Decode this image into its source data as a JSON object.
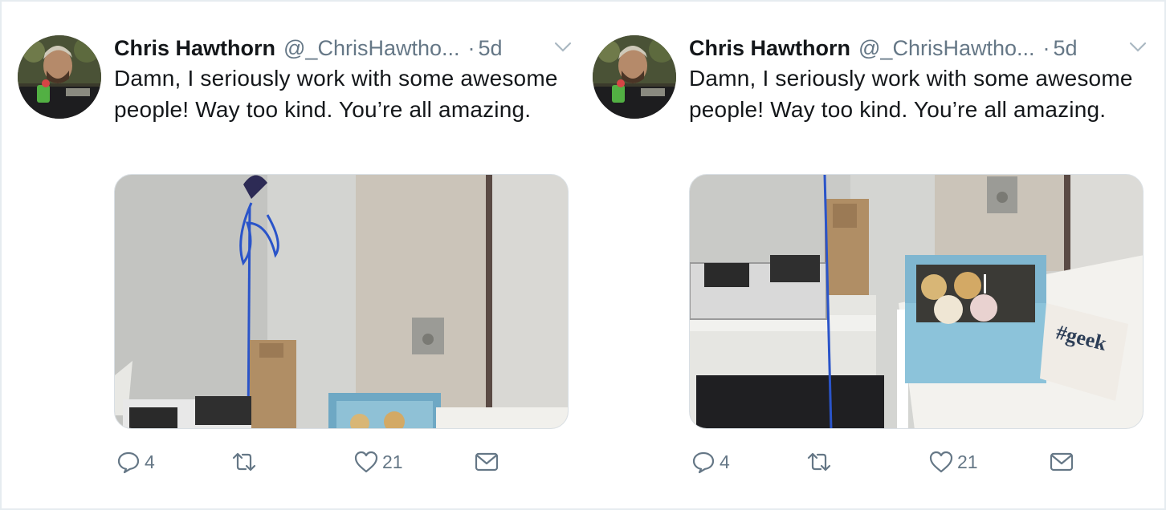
{
  "tweets": [
    {
      "author": {
        "name": "Chris Hawthorn",
        "handle": "@_ChrisHawtho...",
        "separator": "·",
        "time": "5d"
      },
      "text": "Damn, I seriously work with some awesome people! Way too kind. You’re all amazing.",
      "actions": {
        "reply_count": "4",
        "like_count": "21"
      },
      "media": {
        "description_icon": "photo",
        "crop": "left"
      }
    },
    {
      "author": {
        "name": "Chris Hawthorn",
        "handle": "@_ChrisHawtho...",
        "separator": "·",
        "time": "5d"
      },
      "text": "Damn, I seriously work with some awesome people! Way too kind. You’re all amazing.",
      "actions": {
        "reply_count": "4",
        "like_count": "21"
      },
      "media": {
        "card_text": "#geek",
        "crop": "right"
      }
    }
  ],
  "colors": {
    "text": "#14171a",
    "secondary": "#657786",
    "border": "#e6ecf0"
  }
}
